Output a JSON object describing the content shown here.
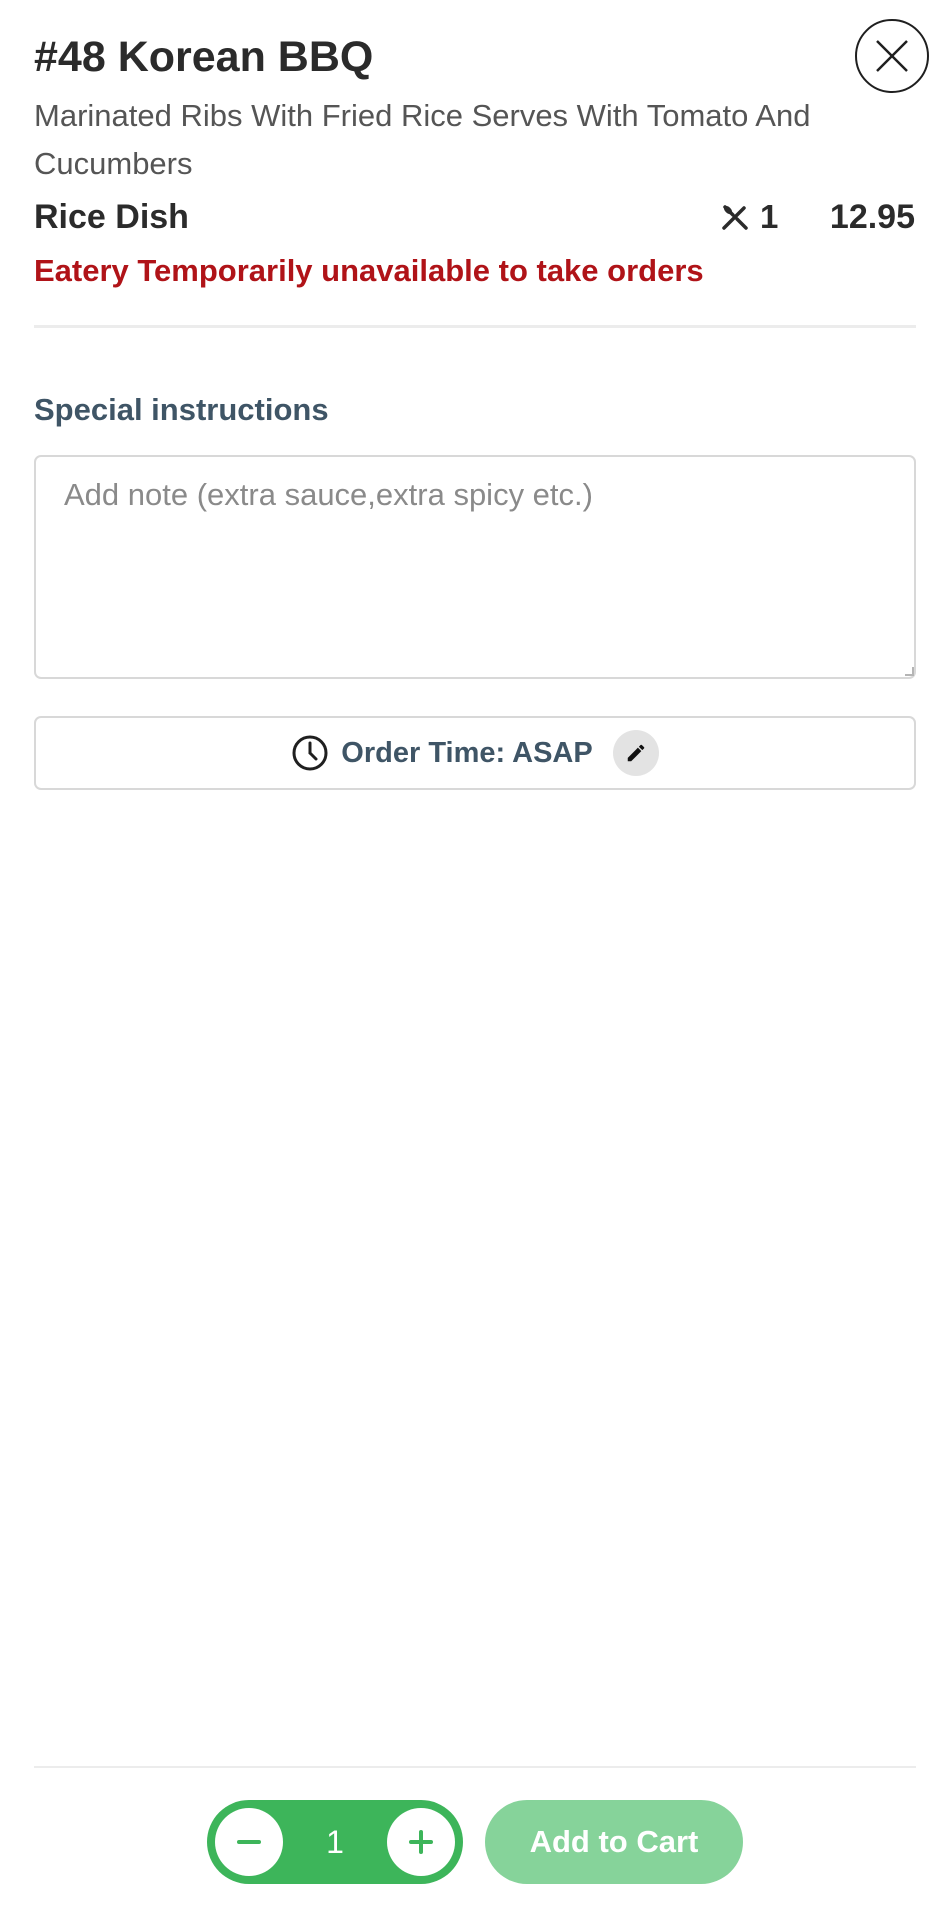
{
  "item": {
    "title": "#48 Korean BBQ",
    "description": "Marinated Ribs With Fried Rice Serves With Tomato And Cucumbers",
    "category": "Rice Dish",
    "serves": "1",
    "price": "12.95",
    "status": "Eatery Temporarily unavailable to take orders"
  },
  "instructions": {
    "label": "Special instructions",
    "placeholder": "Add note (extra sauce,extra spicy etc.)",
    "value": ""
  },
  "order_time": {
    "label": "Order Time: ASAP"
  },
  "cart": {
    "quantity": "1",
    "decrement_symbol": "−",
    "increment_symbol": "+",
    "add_label": "Add to Cart"
  },
  "icons": {
    "close": "close-icon",
    "serves": "fork-spoon-icon",
    "clock": "clock-icon",
    "edit": "pencil-icon",
    "minus": "minus-icon",
    "plus": "plus-icon"
  },
  "colors": {
    "accent_green": "#3db55a",
    "disabled_green": "#86d39a",
    "error_red": "#b01318",
    "label_slate": "#3f5566"
  }
}
